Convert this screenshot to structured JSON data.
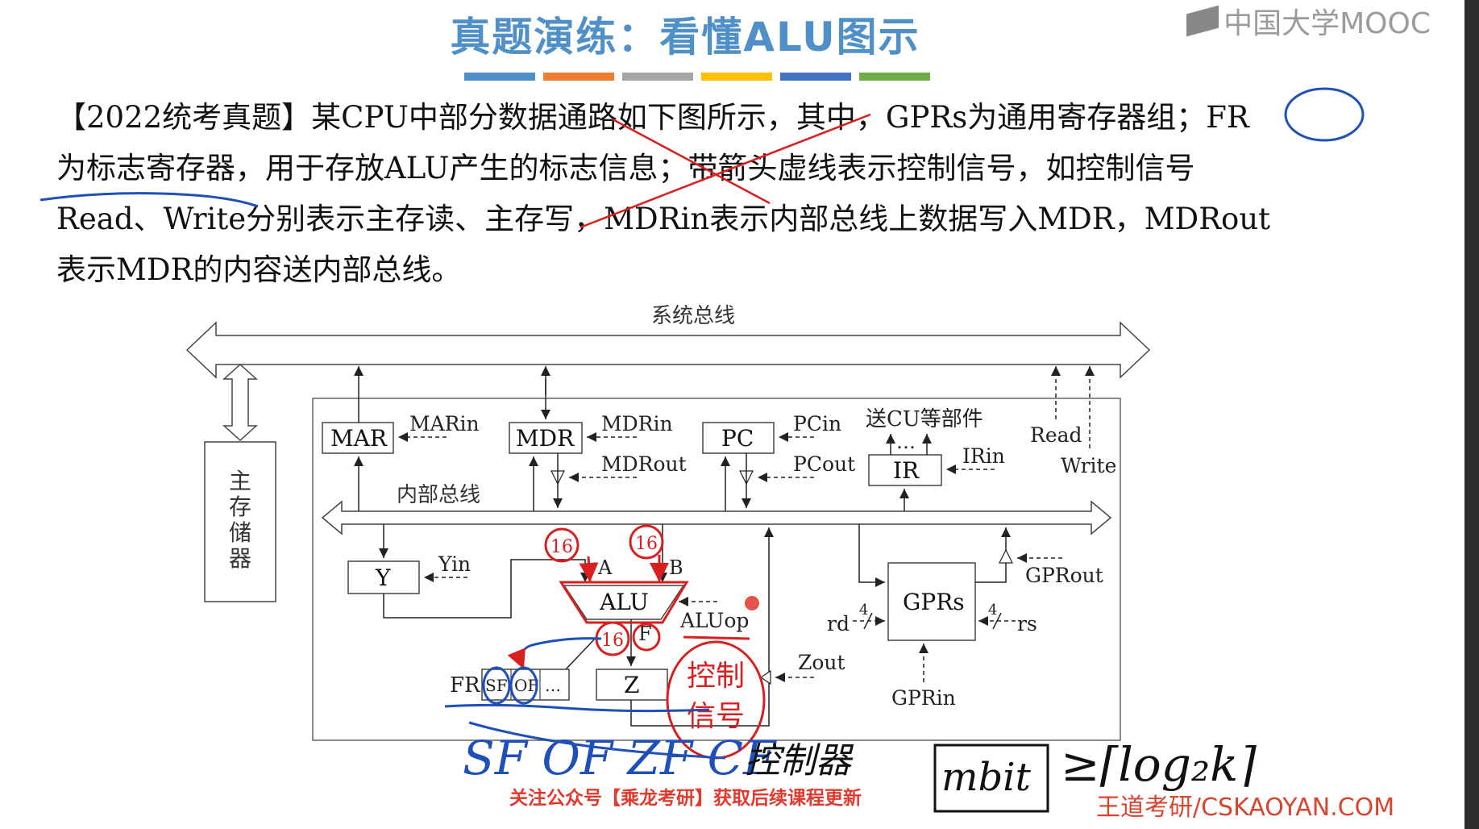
{
  "header": {
    "title": "真题演练：看懂ALU图示",
    "brand": "中国大学MOOC",
    "accent_bars": [
      "#4f90c9",
      "#ed7d31",
      "#a5a5a5",
      "#ffc000",
      "#4472c4",
      "#70ad47"
    ]
  },
  "paragraph": {
    "lines": [
      "【2022统考真题】某CPU中部分数据通路如下图所示，其中，GPRs为通用寄存器组；FR",
      "为标志寄存器，用于存放ALU产生的标志信息；带箭头虚线表示控制信号，如控制信号",
      "Read、Write分别表示主存读、主存写，MDRin表示内部总线上数据写入MDR，MDRout",
      "表示MDR的内容送内部总线。"
    ]
  },
  "diagram": {
    "system_bus": "系统总线",
    "internal_bus": "内部总线",
    "main_memory": "主存储器",
    "registers": {
      "mar": "MAR",
      "mdr": "MDR",
      "pc": "PC",
      "ir": "IR",
      "y": "Y",
      "alu": "ALU",
      "z": "Z",
      "gprs": "GPRs",
      "fr": "FR"
    },
    "signals": {
      "marin": "MARin",
      "mdrin": "MDRin",
      "mdrout": "MDRout",
      "pcin": "PCin",
      "pcout": "PCout",
      "irin": "IRin",
      "to_cu": "送CU等部件",
      "read": "Read",
      "write": "Write",
      "yin": "Yin",
      "aluop": "ALUop",
      "zout": "Zout",
      "gprout": "GPRout",
      "gprin": "GPRin",
      "rd": "rd",
      "rs": "rs",
      "rd_width": "4",
      "rs_width": "4"
    },
    "alu_ports": {
      "a": "A",
      "b": "B",
      "f": "F"
    },
    "fr_bits": [
      "SF",
      "OF",
      "…"
    ],
    "cu_dots": "…"
  },
  "annotations": {
    "width_a": "16",
    "width_b": "16",
    "width_f": "16",
    "control_signal": "控制信号",
    "fr_bits_written": "SF OF ZF CF",
    "controller": "控制器",
    "formula_m": "mbit",
    "formula_rest": "≥⌈log₂k⌉",
    "red_color": "#d92020",
    "blue_color": "#1f4fb8"
  },
  "footer": {
    "follow": "关注公众号【乘龙考研】获取后续课程更新",
    "brand": "王道考研/CSKAOYAN.COM"
  }
}
